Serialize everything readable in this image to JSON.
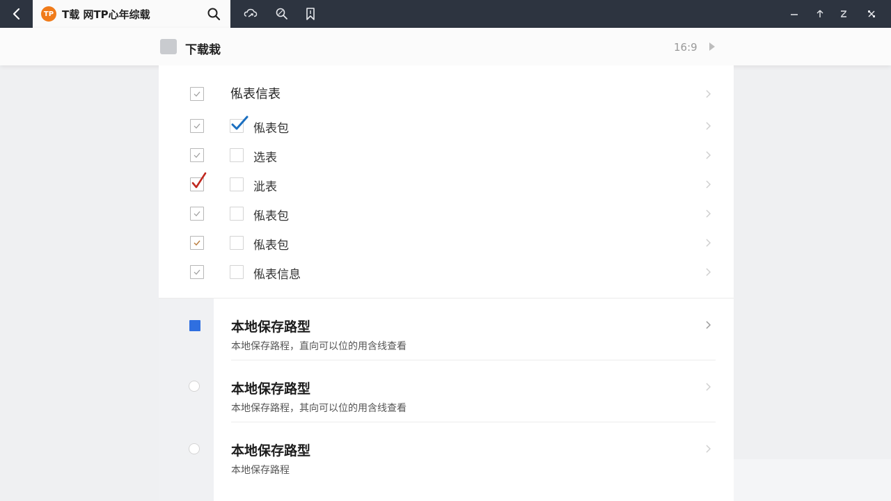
{
  "colors": {
    "topbar": "#2d3440",
    "accent_blue": "#2f6fe0",
    "check_blue": "#1b6fc0",
    "check_red": "#c0281f",
    "check_orange": "#b87a3a",
    "logo_orange": "#f07b1a"
  },
  "tab": {
    "logo_text": "TP",
    "title": "T载 网TP心年综载"
  },
  "icons": {
    "back": "back-arrow-icon",
    "search": "search-icon",
    "toolbar": [
      "cloud-sync-icon",
      "search-tool-icon",
      "bookmark-icon"
    ],
    "window": [
      "minimize-icon",
      "upload-icon",
      "collapse-icon",
      "close-icon"
    ]
  },
  "subheader": {
    "title": "下载栽",
    "ratio": "16:9"
  },
  "checklist": {
    "header": "俬表信表",
    "rows": [
      {
        "label": "俬表包",
        "outer_checked": true,
        "inner_checked": true
      },
      {
        "label": "选表",
        "outer_checked": true,
        "inner_checked": false
      },
      {
        "label": "泚表",
        "outer_checked": true,
        "inner_checked": false
      },
      {
        "label": "俬表包",
        "outer_checked": true,
        "inner_checked": false
      },
      {
        "label": "俬表包",
        "outer_checked": true,
        "inner_checked": false
      },
      {
        "label": "俬表信息",
        "outer_checked": true,
        "inner_checked": false
      }
    ]
  },
  "storage": {
    "items": [
      {
        "title": "本地保存路型",
        "subtitle": "本地保存路程，直向可以位的用含线查看",
        "selected": true
      },
      {
        "title": "本地保存路型",
        "subtitle": "本地保存路程，其向可以位的用含线查看",
        "selected": false
      },
      {
        "title": "本地保存路型",
        "subtitle": "本地保存路程",
        "selected": false
      }
    ]
  }
}
